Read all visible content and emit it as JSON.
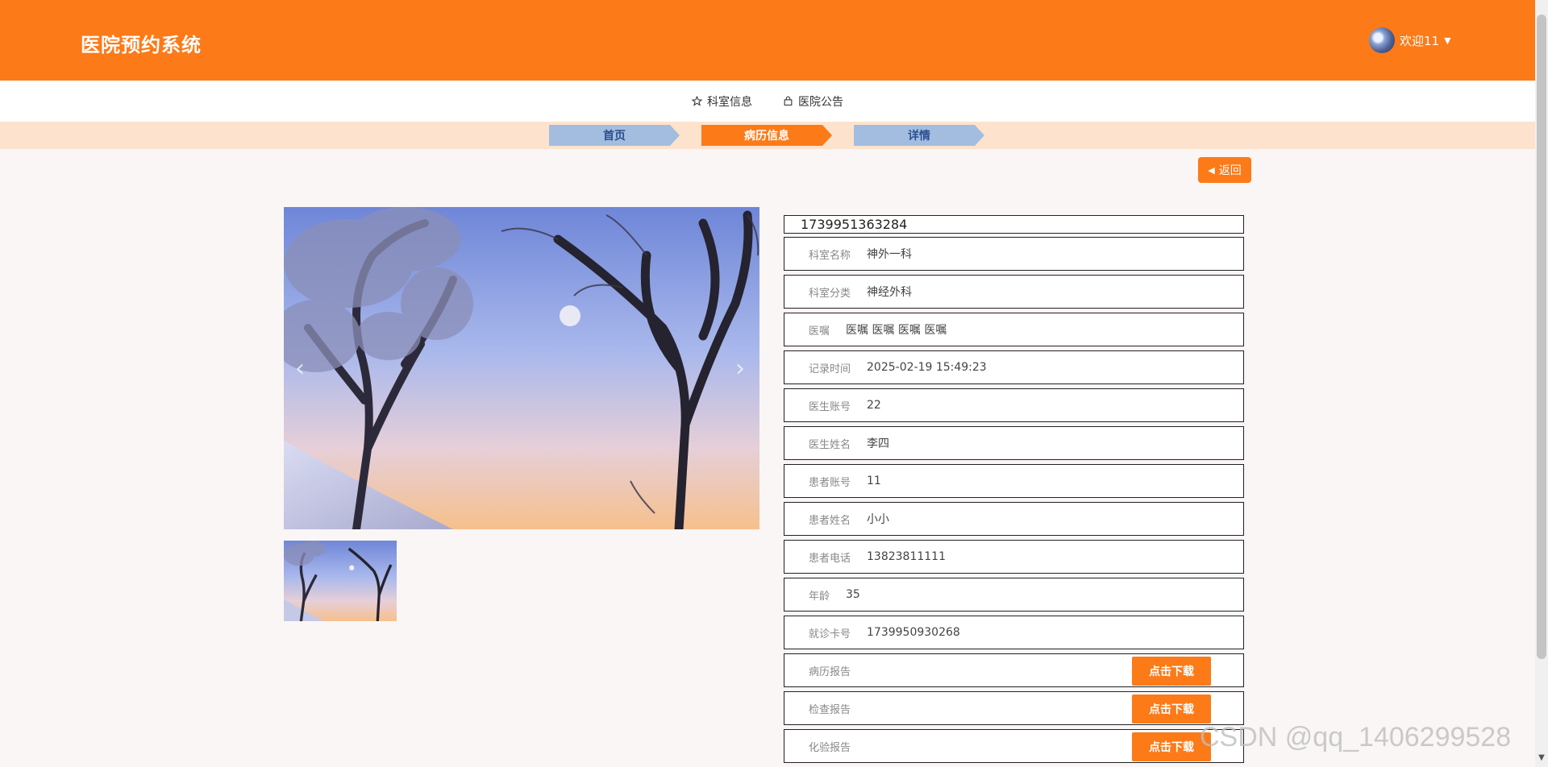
{
  "app": {
    "title": "医院预约系统"
  },
  "user": {
    "greeting": "欢迎11"
  },
  "nav": {
    "items": [
      {
        "label": "科室信息"
      },
      {
        "label": "医院公告"
      }
    ]
  },
  "breadcrumb": [
    {
      "label": "首页"
    },
    {
      "label": "病历信息"
    },
    {
      "label": "详情"
    }
  ],
  "back_label": "返回",
  "record": {
    "id": "1739951363284",
    "fields": [
      {
        "label": "科室名称",
        "value": "神外一科"
      },
      {
        "label": "科室分类",
        "value": "神经外科"
      },
      {
        "label": "医嘱",
        "value": "医嘱 医嘱 医嘱 医嘱"
      },
      {
        "label": "记录时间",
        "value": "2025-02-19 15:49:23"
      },
      {
        "label": "医生账号",
        "value": "22"
      },
      {
        "label": "医生姓名",
        "value": "李四"
      },
      {
        "label": "患者账号",
        "value": "11"
      },
      {
        "label": "患者姓名",
        "value": "小小"
      },
      {
        "label": "患者电话",
        "value": "13823811111"
      },
      {
        "label": "年龄",
        "value": "35"
      },
      {
        "label": "就诊卡号",
        "value": "1739950930268"
      }
    ],
    "reports": [
      {
        "label": "病历报告",
        "button": "点击下载"
      },
      {
        "label": "检查报告",
        "button": "点击下载"
      },
      {
        "label": "化验报告",
        "button": "点击下载"
      }
    ]
  },
  "watermark": "CSDN @qq_1406299528",
  "colors": {
    "primary": "#fc7a18",
    "crumb_inactive": "#a2bde0",
    "strip": "#fde3cd"
  }
}
